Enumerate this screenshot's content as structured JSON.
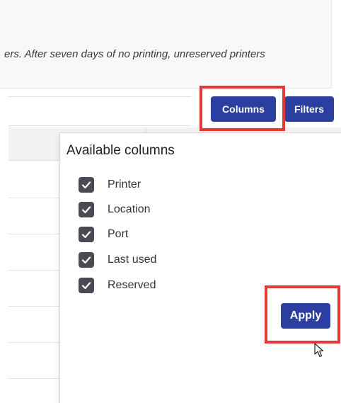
{
  "notice": {
    "text": "ers. After seven days of no printing, unreserved printers"
  },
  "toolbar": {
    "columns_label": "Columns",
    "filters_label": "Filters"
  },
  "popup": {
    "title": "Available columns",
    "options": [
      {
        "label": "Printer",
        "checked": true
      },
      {
        "label": "Location",
        "checked": true
      },
      {
        "label": "Port",
        "checked": true
      },
      {
        "label": "Last used",
        "checked": true
      },
      {
        "label": "Reserved",
        "checked": true
      }
    ],
    "apply_label": "Apply"
  },
  "colors": {
    "button": "#2b3fa0",
    "highlight": "#e53935",
    "checkbox": "#4a4a52"
  },
  "icons": {
    "checkbox": "check-icon",
    "cursor": "mouse-pointer-icon"
  }
}
